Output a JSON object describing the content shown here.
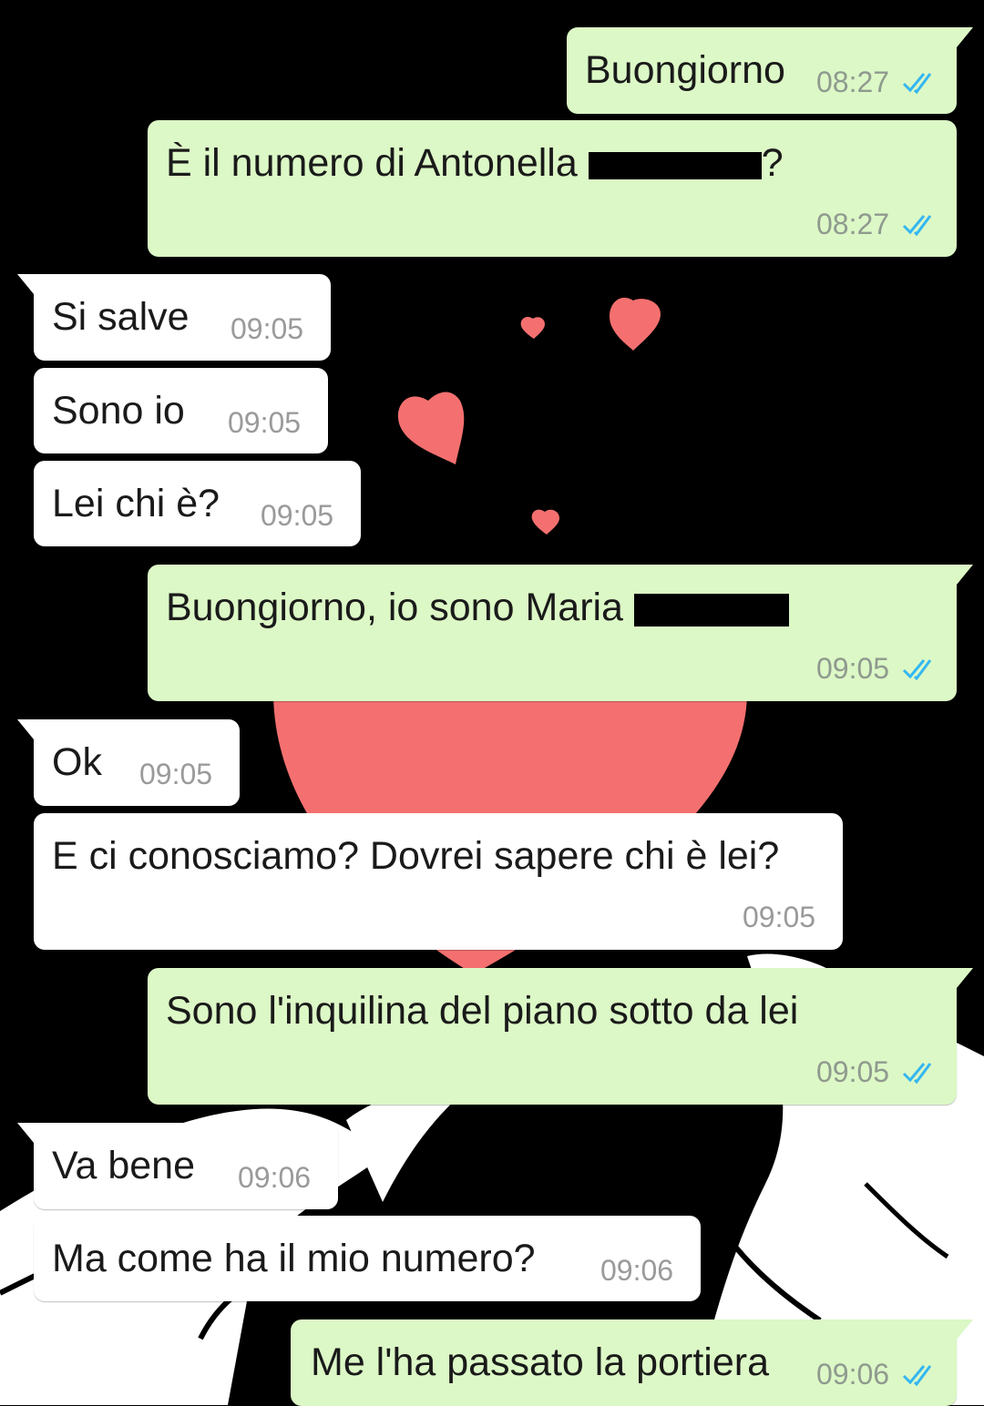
{
  "theme": {
    "outgoing_bubble": "#dcf8c6",
    "incoming_bubble": "#ffffff",
    "read_ticks_color": "#34b7f1",
    "heart_color": "#f47070",
    "wallpaper_background": "#000000"
  },
  "messages": [
    {
      "direction": "outgoing",
      "text": "Buongiorno",
      "time": "08:27",
      "status": "read"
    },
    {
      "direction": "outgoing",
      "text_before": "È il numero di Antonella",
      "text_after": "?",
      "redacted": true,
      "time": "08:27",
      "status": "read"
    },
    {
      "direction": "incoming",
      "text": "Si salve",
      "time": "09:05"
    },
    {
      "direction": "incoming",
      "text": "Sono io",
      "time": "09:05"
    },
    {
      "direction": "incoming",
      "text": "Lei chi è?",
      "time": "09:05"
    },
    {
      "direction": "outgoing",
      "text_before": "Buongiorno, io sono Maria",
      "redacted": true,
      "time": "09:05",
      "status": "read"
    },
    {
      "direction": "incoming",
      "text": "Ok",
      "time": "09:05"
    },
    {
      "direction": "incoming",
      "text": "E ci conosciamo? Dovrei sapere chi è lei?",
      "time": "09:05"
    },
    {
      "direction": "outgoing",
      "text": "Sono l'inquilina del piano sotto da lei",
      "time": "09:05",
      "status": "read"
    },
    {
      "direction": "incoming",
      "text": "Va bene",
      "time": "09:06"
    },
    {
      "direction": "incoming",
      "text": "Ma come ha il mio numero?",
      "time": "09:06"
    },
    {
      "direction": "outgoing",
      "text": "Me l'ha passato la portiera",
      "time": "09:06",
      "status": "read"
    }
  ]
}
